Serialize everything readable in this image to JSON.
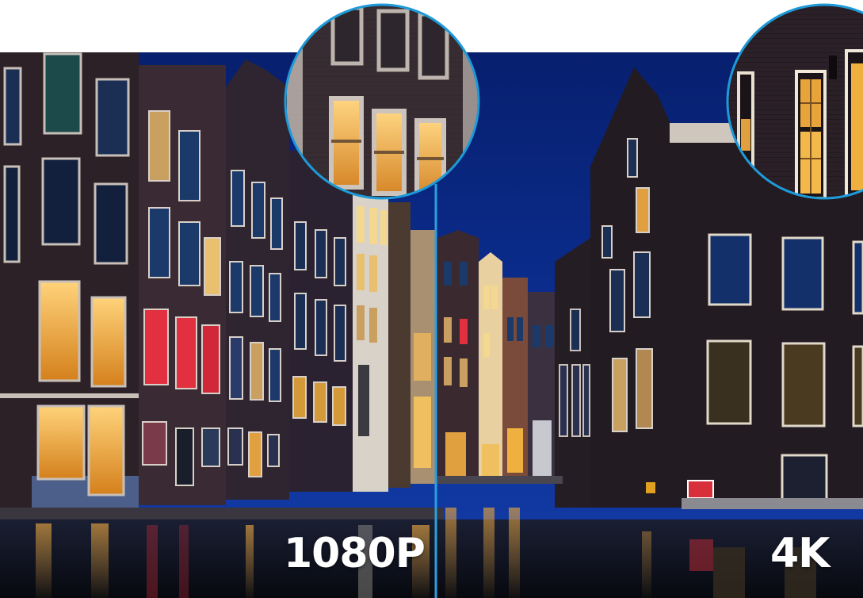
{
  "comparison": {
    "left_label": "1080P",
    "right_label": "4K"
  },
  "colors": {
    "sky": "#0b2a86",
    "divider": "#2aa0e0",
    "magnifier_ring": "#1e9ad8",
    "window_glow": "#f4b03a",
    "red_window": "#e23040"
  }
}
